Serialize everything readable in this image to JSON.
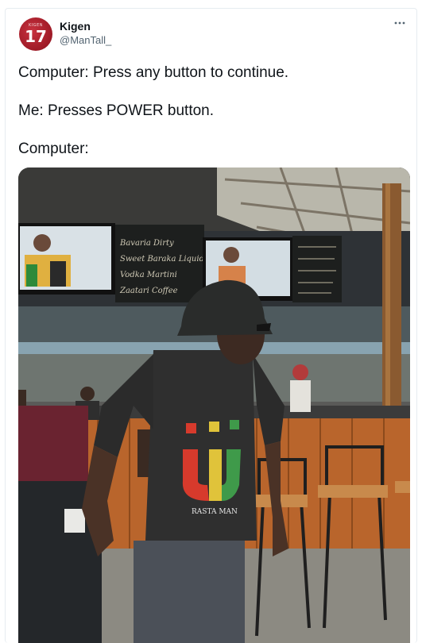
{
  "tweet": {
    "author_name": "Kigen",
    "author_handle": "@ManTall_",
    "avatar": {
      "label": "KIGEN",
      "number": "17",
      "color": "#9e1a26"
    },
    "menu_icon": "more-horizontal-icon",
    "lines": [
      "Computer: Press any button to continue.",
      "Me: Presses POWER button.",
      "Computer:"
    ]
  },
  "photo": {
    "chalkboard_lines": [
      "Bavaria Dirty",
      "Sweet Baraka Liquid",
      "Vodka Martini",
      "Zaatari Coffee"
    ],
    "shirt_text": "RASTA MAN"
  }
}
